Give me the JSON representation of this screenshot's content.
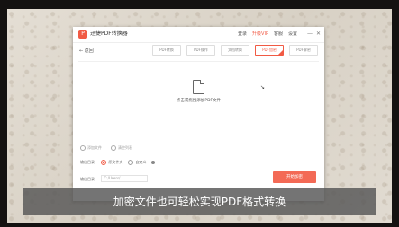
{
  "app": {
    "logo_text": "P",
    "title": "迅捷PDF转换器",
    "menu": [
      "登录",
      "升级VIP",
      "客服",
      "设置"
    ],
    "active_menu_index": 1,
    "window_controls": [
      "—",
      "✕"
    ]
  },
  "nav": {
    "back_label": "← 返回"
  },
  "tabs": [
    {
      "label": "PDF转换",
      "active": false
    },
    {
      "label": "PDF操作",
      "active": false
    },
    {
      "label": "文档转换",
      "active": false
    },
    {
      "label": "PDF加密",
      "active": true
    },
    {
      "label": "PDF解密",
      "active": false
    }
  ],
  "dropzone": {
    "icon": "document-icon",
    "text": "点击或拖拽添加PDF文件",
    "cursor": "↘"
  },
  "file_actions": [
    {
      "label": "添加文件",
      "icon": "add-icon"
    },
    {
      "label": "清空列表",
      "icon": "clear-icon"
    }
  ],
  "output": {
    "label": "输出目录:",
    "options": [
      {
        "label": "原文件夹",
        "selected": true
      },
      {
        "label": "自定义",
        "selected": false
      }
    ]
  },
  "path": {
    "label": "输出目录:",
    "value": "C:/Users/..."
  },
  "start_button": "开始加密",
  "caption": "加密文件也可轻松实现PDF格式转换",
  "colors": {
    "accent": "#f15a44",
    "button": "#f36a56",
    "caption_bg": "#555555"
  }
}
